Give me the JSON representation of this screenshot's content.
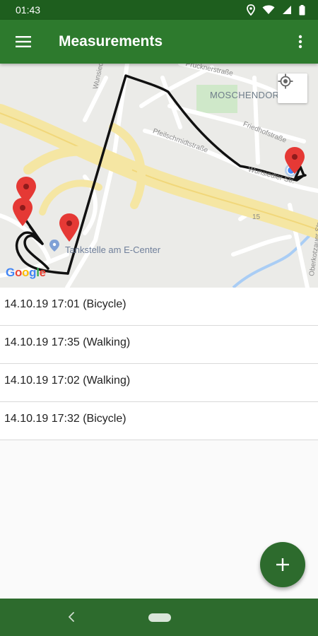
{
  "status_bar": {
    "time": "01:43",
    "icons": [
      "location-icon",
      "wifi-icon",
      "signal-icon",
      "battery-icon"
    ]
  },
  "app_bar": {
    "title": "Measurements",
    "menu_icon": "hamburger-menu-icon",
    "overflow_icon": "more-vert-icon"
  },
  "map": {
    "district_label": "MOSCHENDORF",
    "poi_label": "Tankstelle am E-Center",
    "street_labels": {
      "pruckner": "Prücknerstraße",
      "friedhof": "Friedhofstraße",
      "pfeilschmidt": "Pfeilschmidtstraße",
      "wunsiedler": "Wunsiedler Str.",
      "wunsiedler_2": "Wunsiedler Str.",
      "highway_number": "15",
      "oberkotzauer": "Oberkotzauer Str."
    },
    "attribution": "Google",
    "locate_icon": "my-location-icon",
    "marker_icon": "map-pin-icon"
  },
  "measurements": [
    {
      "label": "14.10.19 17:01 (Bicycle)"
    },
    {
      "label": "14.10.19 17:35 (Walking)"
    },
    {
      "label": "14.10.19 17:02 (Walking)"
    },
    {
      "label": "14.10.19 17:32 (Bicycle)"
    }
  ],
  "fab": {
    "icon": "plus-icon"
  },
  "nav_bar": {
    "back_icon": "back-chevron-icon",
    "home_icon": "home-pill-icon"
  },
  "colors": {
    "status_bar": "#1e5e1e",
    "app_bar": "#2d7a2d",
    "fab": "#2d6b2d",
    "marker": "#e53935",
    "track": "#111111"
  }
}
